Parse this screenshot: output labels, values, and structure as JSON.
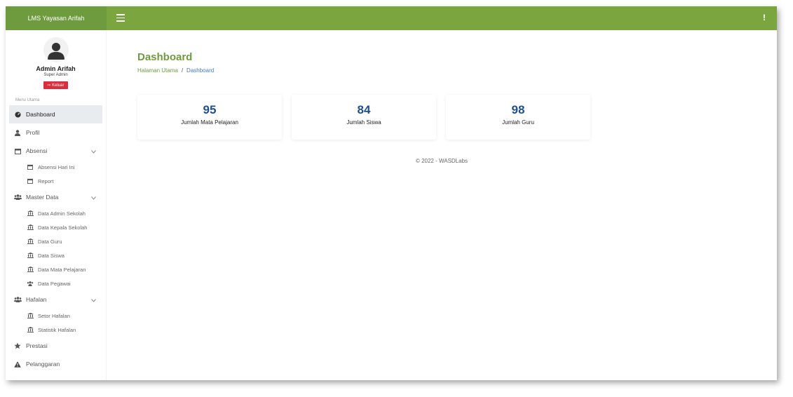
{
  "brand": {
    "title": "LMS Yayasan Arifah"
  },
  "topbar": {
    "alert_label": "!"
  },
  "user": {
    "name": "Admin Arifah",
    "role": "Super Admin",
    "logout_label": "Keluar"
  },
  "sidebar": {
    "menu_header": "Menu Utama",
    "dashboard": "Dashboard",
    "profil": "Profil",
    "absensi": {
      "label": "Absensi",
      "items": [
        "Absensi Hari Ini",
        "Report"
      ]
    },
    "master_data": {
      "label": "Master Data",
      "items": [
        "Data Admin Sekolah",
        "Data Kepala Sekolah",
        "Data Guru",
        "Data Siswa",
        "Data Mata Pelajaran",
        "Data Pegawai"
      ]
    },
    "hafalan": {
      "label": "Hafalan",
      "items": [
        "Setor Hafalan",
        "Statistik Hafalan"
      ]
    },
    "prestasi": "Prestasi",
    "pelanggaran": "Pelanggaran"
  },
  "page": {
    "title": "Dashboard",
    "breadcrumb_home": "Halaman Utama",
    "breadcrumb_sep": "/",
    "breadcrumb_current": "Dashboard"
  },
  "cards": [
    {
      "value": "95",
      "label": "Jumlah Mata Pelajaran"
    },
    {
      "value": "84",
      "label": "Jumlah Siswa"
    },
    {
      "value": "98",
      "label": "Jumlah Guru"
    }
  ],
  "footer": {
    "text": "© 2022 - WASDLabs"
  },
  "colors": {
    "brand": "#6f9b3f",
    "topbar": "#7aa53f",
    "logout": "#d92d3b",
    "card_value": "#1f4f8c"
  }
}
